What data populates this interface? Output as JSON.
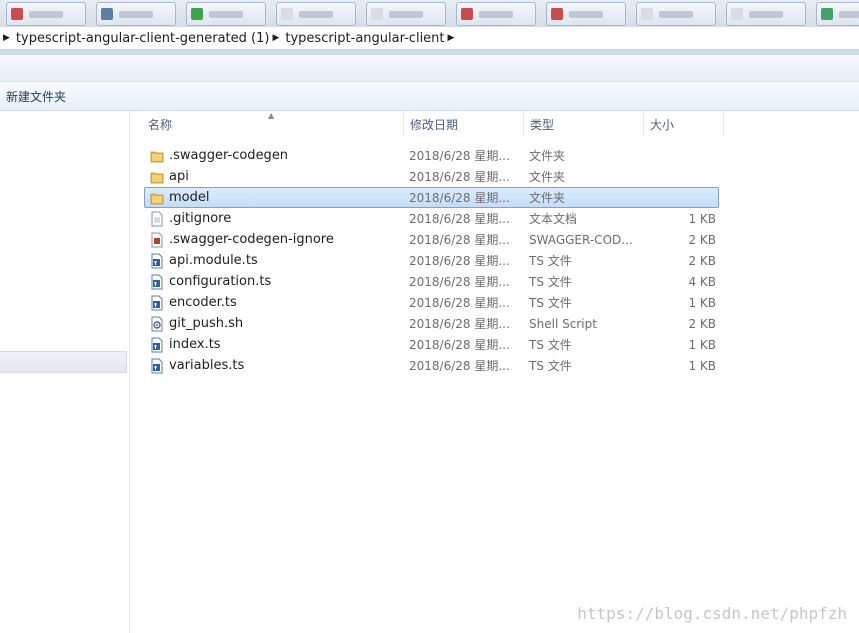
{
  "breadcrumb": {
    "segments": [
      "typescript-angular-client-generated (1)",
      "typescript-angular-client"
    ]
  },
  "commandbar": {
    "new_folder_label": "新建文件夹"
  },
  "columns": {
    "name": "名称",
    "date": "修改日期",
    "type": "类型",
    "size": "大小"
  },
  "files": [
    {
      "name": ".swagger-codegen",
      "date": "2018/6/28 星期...",
      "type": "文件夹",
      "size": "",
      "icon": "folder-icon",
      "selected": false
    },
    {
      "name": "api",
      "date": "2018/6/28 星期...",
      "type": "文件夹",
      "size": "",
      "icon": "folder-icon",
      "selected": false
    },
    {
      "name": "model",
      "date": "2018/6/28 星期...",
      "type": "文件夹",
      "size": "",
      "icon": "folder-icon",
      "selected": true
    },
    {
      "name": ".gitignore",
      "date": "2018/6/28 星期...",
      "type": "文本文档",
      "size": "1 KB",
      "icon": "text-file-icon",
      "selected": false
    },
    {
      "name": ".swagger-codegen-ignore",
      "date": "2018/6/28 星期...",
      "type": "SWAGGER-COD...",
      "size": "2 KB",
      "icon": "generic-file-icon",
      "selected": false
    },
    {
      "name": "api.module.ts",
      "date": "2018/6/28 星期...",
      "type": "TS 文件",
      "size": "2 KB",
      "icon": "ts-file-icon",
      "selected": false
    },
    {
      "name": "configuration.ts",
      "date": "2018/6/28 星期...",
      "type": "TS 文件",
      "size": "4 KB",
      "icon": "ts-file-icon",
      "selected": false
    },
    {
      "name": "encoder.ts",
      "date": "2018/6/28 星期...",
      "type": "TS 文件",
      "size": "1 KB",
      "icon": "ts-file-icon",
      "selected": false
    },
    {
      "name": "git_push.sh",
      "date": "2018/6/28 星期...",
      "type": "Shell Script",
      "size": "2 KB",
      "icon": "shell-script-icon",
      "selected": false
    },
    {
      "name": "index.ts",
      "date": "2018/6/28 星期...",
      "type": "TS 文件",
      "size": "1 KB",
      "icon": "ts-file-icon",
      "selected": false
    },
    {
      "name": "variables.ts",
      "date": "2018/6/28 星期...",
      "type": "TS 文件",
      "size": "1 KB",
      "icon": "ts-file-icon",
      "selected": false
    }
  ],
  "watermark": "https://blog.csdn.net/phpfzh",
  "colors": {
    "selection": "#cce4f9",
    "folder": "#e8b94a",
    "accent": "#1e3c5a"
  }
}
